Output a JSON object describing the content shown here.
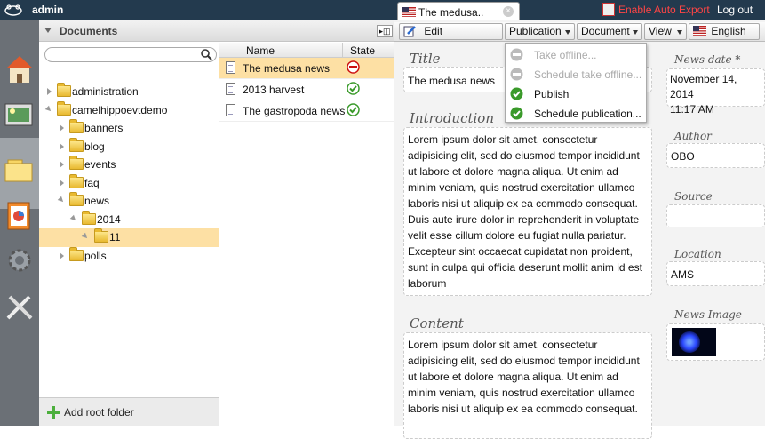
{
  "topbar": {
    "user": "admin",
    "doc_tab_title": "The medusa..",
    "auto_export": "Enable Auto Export",
    "logout": "Log out"
  },
  "tree_panel": {
    "title": "Documents",
    "search_placeholder": "",
    "items": [
      {
        "label": "administration"
      },
      {
        "label": "camelhippoevtdemo"
      },
      {
        "label": "banners"
      },
      {
        "label": "blog"
      },
      {
        "label": "events"
      },
      {
        "label": "faq"
      },
      {
        "label": "news"
      },
      {
        "label": "2014"
      },
      {
        "label": "11"
      },
      {
        "label": "polls"
      }
    ],
    "add_root": "Add root folder"
  },
  "list_panel": {
    "col_name": "Name",
    "col_state": "State",
    "rows": [
      {
        "name": "The medusa news",
        "state": "offline"
      },
      {
        "name": "2013 harvest",
        "state": "published"
      },
      {
        "name": "The gastropoda news",
        "state": "published"
      }
    ]
  },
  "toolbar": {
    "edit": "Edit",
    "publication": "Publication",
    "document": "Document",
    "view": "View",
    "language": "English"
  },
  "publication_menu": {
    "items": [
      {
        "label": "Take offline...",
        "enabled": false
      },
      {
        "label": "Schedule take offline...",
        "enabled": false
      },
      {
        "label": "Publish",
        "enabled": true
      },
      {
        "label": "Schedule publication...",
        "enabled": true
      }
    ]
  },
  "form": {
    "title_label": "Title",
    "title_value": "The medusa news",
    "intro_label": "Introduction",
    "intro_value": "Lorem ipsum dolor sit amet, consectetur adipisicing elit, sed do eiusmod tempor incididunt ut labore et dolore magna aliqua. Ut enim ad minim veniam, quis nostrud exercitation ullamco laboris nisi ut aliquip ex ea commodo consequat. Duis aute irure dolor in reprehenderit in voluptate velit esse cillum dolore eu fugiat nulla pariatur. Excepteur sint occaecat cupidatat non proident, sunt in culpa qui officia deserunt mollit anim id est laborum",
    "content_label": "Content",
    "content_value": "Lorem ipsum dolor sit amet, consectetur adipisicing elit, sed do eiusmod tempor incididunt ut labore et dolore magna aliqua. Ut enim ad minim veniam, quis nostrud exercitation ullamco laboris nisi ut aliquip ex ea commodo consequat.",
    "news_date_label": "News date *",
    "news_date_value": "November 14, 2014",
    "news_time_value": "11:17 AM",
    "author_label": "Author",
    "author_value": "OBO",
    "source_label": "Source",
    "source_value": "",
    "location_label": "Location",
    "location_value": "AMS",
    "news_image_label": "News Image"
  }
}
